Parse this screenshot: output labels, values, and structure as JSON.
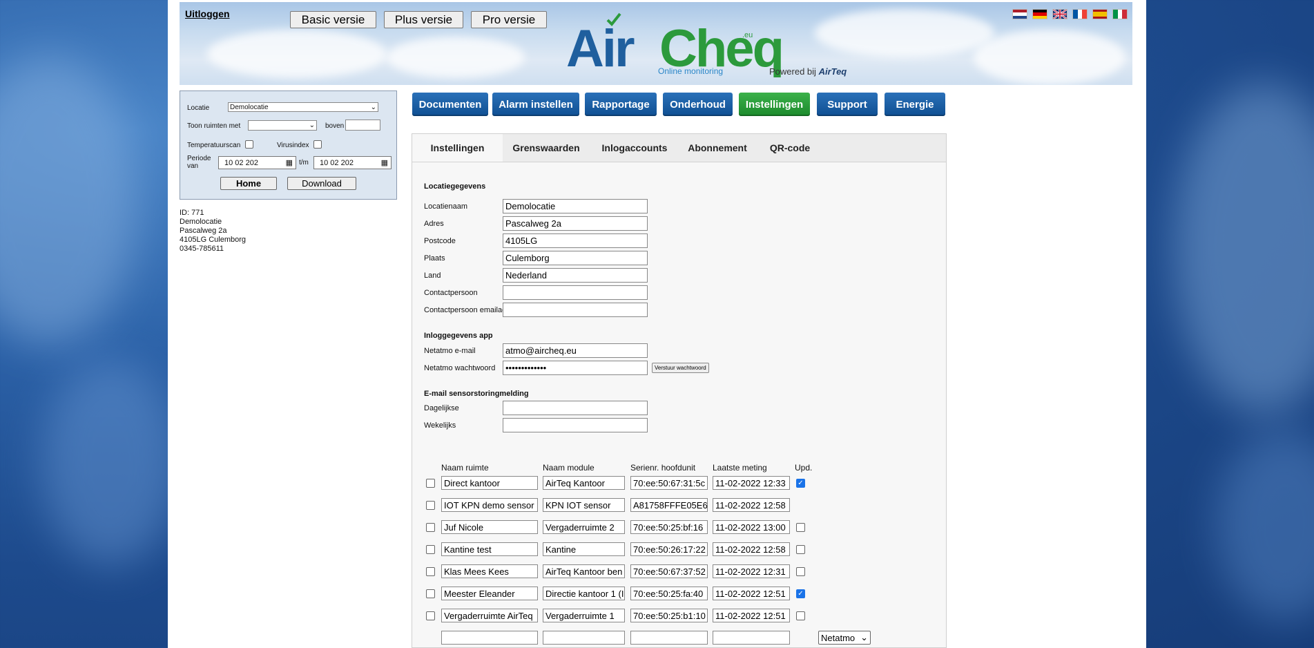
{
  "header": {
    "logout": "Uitloggen",
    "versions": [
      "Basic versie",
      "Plus versie",
      "Pro versie"
    ],
    "logo": {
      "air": "Air",
      "cheq": "Cheq",
      "eu": ".eu",
      "subtitle": "Online monitoring"
    },
    "powered_by": "Powered bij",
    "powered_brand": "AirTeq",
    "flags": [
      "nl",
      "de",
      "gb",
      "fr",
      "es",
      "it"
    ]
  },
  "filter": {
    "locatie_label": "Locatie",
    "locatie_value": "Demolocatie",
    "toon_label": "Toon ruimten met",
    "toon_value": "",
    "boven_label": "boven",
    "temperatuurscan_label": "Temperatuurscan",
    "virusindex_label": "Virusindex",
    "periode_label": "Periode van",
    "date_from": "10 02 202",
    "tm_label": "t/m",
    "date_to": "10 02 202",
    "home_button": "Home",
    "download_button": "Download"
  },
  "address": [
    "ID: 771",
    "Demolocatie",
    "Pascalweg 2a",
    "4105LG Culemborg",
    "0345-785611"
  ],
  "nav": [
    "Documenten",
    "Alarm instellen",
    "Rapportage",
    "Onderhoud",
    "Instellingen",
    "Support",
    "Energie"
  ],
  "active_nav": "Instellingen",
  "tabs": [
    "Instellingen",
    "Grenswaarden",
    "Inlogaccounts",
    "Abonnement",
    "QR-code"
  ],
  "locatie": {
    "title": "Locatiegegevens",
    "fields": [
      {
        "label": "Locatienaam",
        "value": "Demolocatie"
      },
      {
        "label": "Adres",
        "value": "Pascalweg 2a"
      },
      {
        "label": "Postcode",
        "value": "4105LG"
      },
      {
        "label": "Plaats",
        "value": "Culemborg"
      },
      {
        "label": "Land",
        "value": "Nederland"
      },
      {
        "label": "Contactpersoon",
        "value": ""
      },
      {
        "label": "Contactpersoon emailadres",
        "value": ""
      }
    ]
  },
  "app": {
    "title": "Inloggegevens app",
    "email_label": "Netatmo e-mail",
    "email_value": "atmo@aircheq.eu",
    "password_label": "Netatmo wachtwoord",
    "password_value": "•••••••••••••",
    "send_button": "Verstuur wachtwoord"
  },
  "storing": {
    "title": "E-mail sensorstoringmelding",
    "daily_label": "Dagelijkse",
    "daily_value": "",
    "weekly_label": "Wekelijks",
    "weekly_value": ""
  },
  "table": {
    "headers": [
      "Naam ruimte",
      "Naam module",
      "Serienr. hoofdunit",
      "Laatste meting",
      "Upd."
    ],
    "rows": [
      {
        "ruimte": "Direct kantoor",
        "module": "AirTeq Kantoor",
        "serie": "70:ee:50:67:31:5c",
        "meting": "11-02-2022 12:33",
        "upd": true
      },
      {
        "ruimte": "IOT KPN demo sensor",
        "module": "KPN IOT sensor",
        "serie": "A81758FFFE05E6",
        "meting": "11-02-2022 12:58",
        "upd": null
      },
      {
        "ruimte": "Juf Nicole",
        "module": "Vergaderruimte 2",
        "serie": "70:ee:50:25:bf:16",
        "meting": "11-02-2022 13:00",
        "upd": false
      },
      {
        "ruimte": "Kantine test",
        "module": "Kantine",
        "serie": "70:ee:50:26:17:22",
        "meting": "11-02-2022 12:58",
        "upd": false
      },
      {
        "ruimte": "Klas Mees Kees",
        "module": "AirTeq Kantoor ben",
        "serie": "70:ee:50:67:37:52",
        "meting": "11-02-2022 12:31",
        "upd": false
      },
      {
        "ruimte": "Meester Eleander",
        "module": "Directie kantoor 1 (I",
        "serie": "70:ee:50:25:fa:40",
        "meting": "11-02-2022 12:51",
        "upd": true
      },
      {
        "ruimte": "Vergaderruimte AirTeq",
        "module": "Vergaderruimte 1",
        "serie": "70:ee:50:25:b1:10",
        "meting": "11-02-2022 12:51",
        "upd": false
      }
    ],
    "new_row_type": "Netatmo"
  }
}
